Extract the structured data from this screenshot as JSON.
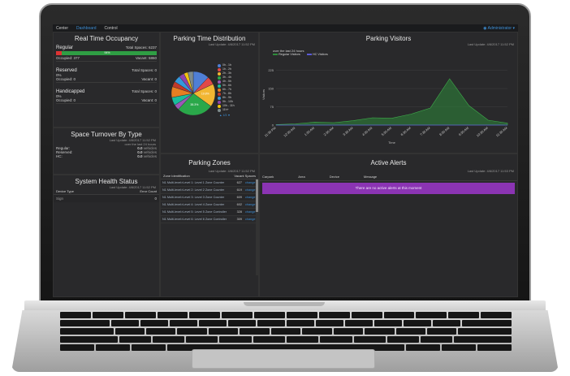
{
  "nav": {
    "tabs": [
      "Center",
      "Dashboard",
      "Control"
    ],
    "active_tab": "Dashboard",
    "user": "Administrator"
  },
  "occupancy": {
    "title": "Real Time Occupancy",
    "regular": {
      "name": "Regular",
      "total_label": "Total Spaces: 6237",
      "percent": "94%",
      "occupied": "Occupied: 377",
      "vacant": "Vacant: 5860",
      "fill": 0.06
    },
    "reserved": {
      "name": "Reserved",
      "total_label": "Total Spaces: 0",
      "percent": "0%",
      "occupied": "Occupied: 0",
      "vacant": "Vacant: 0"
    },
    "handicapped": {
      "name": "Handicapped",
      "total_label": "Total Spaces: 0",
      "percent": "0%",
      "occupied": "Occupied: 0",
      "vacant": "Vacant: 0"
    }
  },
  "turnover": {
    "title": "Space Turnover By Type",
    "last_update": "Last Update: 4/6/2017 11:52 PM",
    "window": "over the last 24 hours",
    "rows": [
      {
        "label": "Regular:",
        "value": "0.0",
        "unit": "vehicles"
      },
      {
        "label": "Reserved:",
        "value": "0.0",
        "unit": "vehicles"
      },
      {
        "label": "HC:",
        "value": "0.0",
        "unit": "vehicles"
      }
    ]
  },
  "health": {
    "title": "System Health Status",
    "last_update": "Last Update: 4/6/2017 11:52 PM",
    "col_device": "Device Type",
    "col_error": "Error Count",
    "rows": [
      {
        "device": "Sign",
        "errors": "0"
      }
    ]
  },
  "parking_time": {
    "title": "Parking Time Distribution",
    "last_update": "Last Update: 4/6/2017 11:52 PM",
    "legend": [
      "0h - 1h",
      "1h - 2h",
      "2h - 3h",
      "3h - 4h",
      "4h - 5h",
      "5h - 6h",
      "6h - 7h",
      "7h - 8h",
      "8h - 9h",
      "9h - 10h",
      "10h - 11h",
      "11h+"
    ],
    "colors": [
      "#4f7fd6",
      "#e04848",
      "#f2b632",
      "#2aa84a",
      "#9b59b6",
      "#1abc9c",
      "#e67e22",
      "#c0392b",
      "#3498db",
      "#8e44ad",
      "#f1c40f",
      "#7f8c8d"
    ],
    "slices": [
      12,
      6,
      17,
      27,
      4,
      6,
      8,
      4,
      5,
      4,
      3,
      4
    ],
    "slice_labels": [
      "",
      "",
      "19.8%",
      "38.3%",
      "",
      "",
      "",
      "",
      "",
      "",
      "",
      ""
    ],
    "pager": "1/3"
  },
  "visitors": {
    "title": "Parking Visitors",
    "last_update": "Last Update: 4/6/2017 11:52 PM",
    "window": "over the last 24 hours",
    "legend": [
      "Regular Visitors",
      "HC Visitors"
    ],
    "colors": [
      "#2e8b3a",
      "#5b5bd6"
    ],
    "ylabel": "Visitors",
    "xlabel": "Time",
    "yticks": [
      "0",
      "75",
      "150",
      "225"
    ]
  },
  "chart_data": {
    "type": "area",
    "title": "Parking Visitors",
    "xlabel": "Time",
    "ylabel": "Visitors",
    "ylim": [
      0,
      250
    ],
    "x": [
      "11:30 PM",
      "12:30 AM",
      "1:30 AM",
      "2:30 AM",
      "3:30 AM",
      "4:30 AM",
      "5:30 AM",
      "6:30 AM",
      "7:30 AM",
      "8:30 AM",
      "9:30 AM",
      "10:30 AM",
      "11:30 AM"
    ],
    "series": [
      {
        "name": "Regular Visitors",
        "values": [
          2,
          5,
          12,
          10,
          18,
          30,
          28,
          45,
          70,
          190,
          80,
          20,
          8
        ]
      },
      {
        "name": "HC Visitors",
        "values": [
          0,
          0,
          0,
          0,
          0,
          0,
          0,
          0,
          0,
          0,
          0,
          0,
          0
        ]
      }
    ]
  },
  "zones": {
    "title": "Parking Zones",
    "last_update": "Last Update: 4/6/2017 11:52 PM",
    "col_zone": "Zone Identification",
    "col_vacant": "Vacant Spaces",
    "change_label": "change",
    "rows": [
      {
        "zone": "N1 Multi-level>Level 1: Level 1 Zone Counter",
        "vacant": "627"
      },
      {
        "zone": "N1 Multi-level>Level 2: Level 2 Zone Counter",
        "vacant": "619"
      },
      {
        "zone": "N1 Multi-level>Level 3: Level 3 Zone Counter",
        "vacant": "609"
      },
      {
        "zone": "N1 Multi-level>Level 4: Level 4 Zone Counter",
        "vacant": "602"
      },
      {
        "zone": "N1 Multi-level>Level 5: Level 5 Zone Controller",
        "vacant": "328"
      },
      {
        "zone": "N1 Multi-level>Level 6: Level 6 Zone Controller",
        "vacant": "309"
      }
    ]
  },
  "alerts": {
    "title": "Active Alerts",
    "last_update": "Last Update: 4/6/2017 11:53 PM",
    "columns": [
      "Carpark",
      "Area",
      "Device",
      "Message"
    ],
    "empty_message": "There are no active alerts at this moment"
  }
}
